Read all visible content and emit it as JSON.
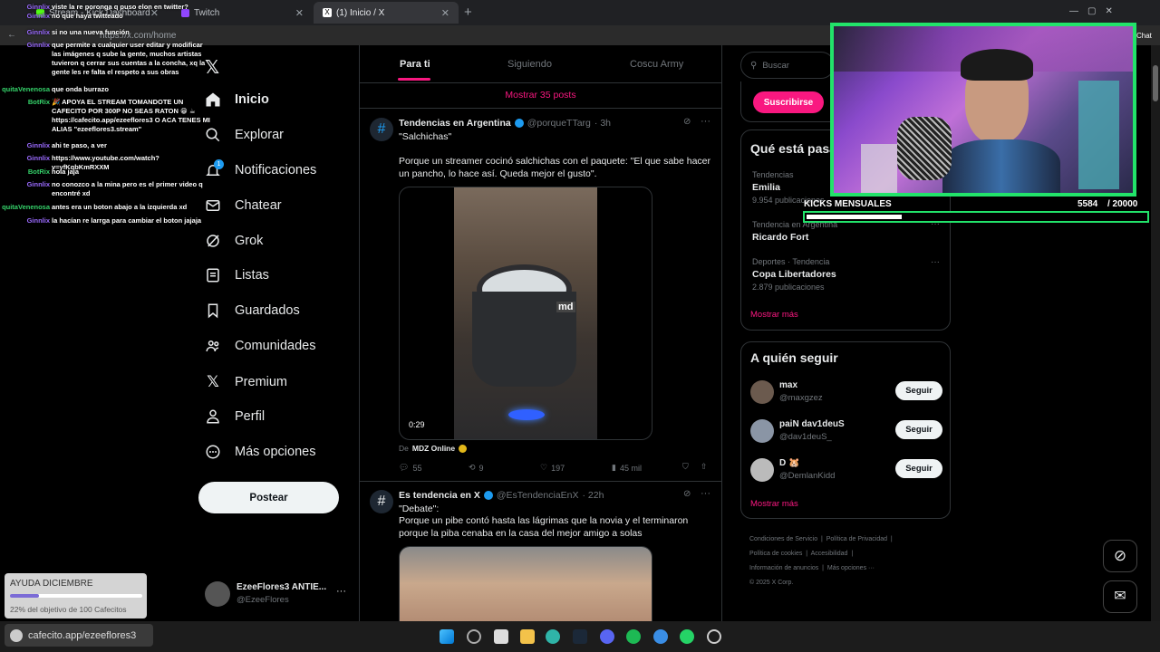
{
  "browser": {
    "tabs": [
      {
        "label": "Stream - Kick Dashboard"
      },
      {
        "label": "Twitch"
      },
      {
        "label": "(1) Inicio / X"
      }
    ],
    "new_tab": "+",
    "url": "https://x.com/home",
    "window_controls": [
      "—",
      "▢",
      "✕"
    ]
  },
  "nav": {
    "items": [
      {
        "label": "Inicio",
        "icon": "home-icon"
      },
      {
        "label": "Explorar",
        "icon": "search-icon"
      },
      {
        "label": "Notificaciones",
        "icon": "bell-icon",
        "badge": "1"
      },
      {
        "label": "Chatear",
        "icon": "mail-icon"
      },
      {
        "label": "Grok",
        "icon": "grok-icon"
      },
      {
        "label": "Listas",
        "icon": "list-icon"
      },
      {
        "label": "Guardados",
        "icon": "bookmark-icon"
      },
      {
        "label": "Comunidades",
        "icon": "people-icon"
      },
      {
        "label": "Premium",
        "icon": "x-logo-icon"
      },
      {
        "label": "Perfil",
        "icon": "person-icon"
      },
      {
        "label": "Más opciones",
        "icon": "more-icon"
      }
    ],
    "post_button": "Postear",
    "account": {
      "name": "EzeeFlores3 ANTIE...",
      "handle": "@EzeeFlores"
    }
  },
  "feed": {
    "tabs": [
      "Para ti",
      "Siguiendo",
      "Coscu Army"
    ],
    "show_more": "Mostrar 35 posts",
    "posts": [
      {
        "author": "Tendencias en Argentina",
        "handle": "@porqueTTarg",
        "time": "· 3h",
        "title": "\"Salchichas\"",
        "body": "Porque un streamer cocinó salchichas con el paquete: \"El que sabe hacer un pancho, lo hace así. Queda mejor el gusto\".",
        "video_duration": "0:29",
        "watermark": "md",
        "source_prefix": "De",
        "source": "MDZ Online",
        "replies": "55",
        "reposts": "9",
        "likes": "197",
        "views": "45 mil"
      },
      {
        "author": "Es tendencia en X",
        "handle": "@EsTendenciaEnX",
        "time": "· 22h",
        "title": "\"Debate\":",
        "body": "Porque un pibe contó hasta las lágrimas que la novia y el terminaron porque la piba cenaba en la casa del mejor amigo a solas"
      }
    ]
  },
  "sidebar": {
    "search_placeholder": "Buscar",
    "subscribe": "Suscribirse",
    "trends_title": "Qué está pasa",
    "trends": [
      {
        "context": "Tendencias",
        "name": "Emilia",
        "count": "9.954 publicaciones"
      },
      {
        "context": "Tendencia en Argentina",
        "name": "Ricardo Fort",
        "count": ""
      },
      {
        "context": "Deportes · Tendencia",
        "name": "Copa Libertadores",
        "count": "2.879 publicaciones"
      }
    ],
    "show_more": "Mostrar más",
    "follow_title": "A quién seguir",
    "follow": [
      {
        "name": "max",
        "handle": "@maxgzez",
        "button": "Seguir"
      },
      {
        "name": "paiN dav1deuS",
        "handle": "@dav1deuS_",
        "button": "Seguir"
      },
      {
        "name": "D 🐹",
        "handle": "@DemlanKidd",
        "button": "Seguir"
      }
    ],
    "footer": [
      "Condiciones de Servicio",
      "Política de Privacidad",
      "Política de cookies",
      "Accesibilidad",
      "Información de anuncios",
      "Más opciones ···",
      "© 2025 X Corp."
    ]
  },
  "stream_overlay": {
    "kicks_label": "KICKS MENSUALES",
    "kicks_value": "5584",
    "kicks_goal": "/ 20000",
    "kicks_progress": 0.28,
    "goal_title": "AYUDA DICIEMBRE",
    "goal_text": "22% del objetivo de 100 Cafecitos",
    "goal_progress": 0.22,
    "cafecito_url": "cafecito.app/ezeeflores3",
    "chat_label": "Chat"
  },
  "chat": [
    {
      "user": "Ginnlix",
      "msg": "viste la re poronga q puso elon en twitter?"
    },
    {
      "user": "Ginnlix",
      "msg": "no que haya twitteado"
    },
    {
      "user": "Ginnlix",
      "msg": "si no una nueva función"
    },
    {
      "user": "Ginnlix",
      "msg": "que permite a cualquier user editar y modificar las imágenes q sube la gente, muchos artistas tuvieron q cerrar sus cuentas a la concha, xq la gente les re falta el respeto a sus obras"
    },
    {
      "user": "quitaVenenosa",
      "msg": "que onda burrazo"
    },
    {
      "user": "BotRix",
      "msg": "🎉 APOYA EL STREAM TOMANDOTE UN CAFECITO POR 300P NO SEAS RATON 😁 ☕ https://cafecito.app/ezeeflores3 O ACA TENES MI ALIAS \"ezeeflores3.stream\""
    },
    {
      "user": "Ginnlix",
      "msg": "ahi te paso, a ver"
    },
    {
      "user": "Ginnlix",
      "msg": "https://www.youtube.com/watch?v=yfKqbKmRXXM"
    },
    {
      "user": "BotRix",
      "msg": "hola jaja"
    },
    {
      "user": "Ginnlix",
      "msg": "no conozco a la mina pero es el primer video q encontré xd"
    },
    {
      "user": "quitaVenenosa",
      "msg": "antes era un boton abajo a la izquierda xd"
    },
    {
      "user": "Ginnlix",
      "msg": "la hacían re larrga para cambiar el boton jajaja"
    }
  ],
  "colors": {
    "accent": "#f91880",
    "verified": "#1d9bf0",
    "cam_border": "#22e36a",
    "chat_user": "#9b6bff",
    "chat_venenosa": "#35d26a"
  }
}
